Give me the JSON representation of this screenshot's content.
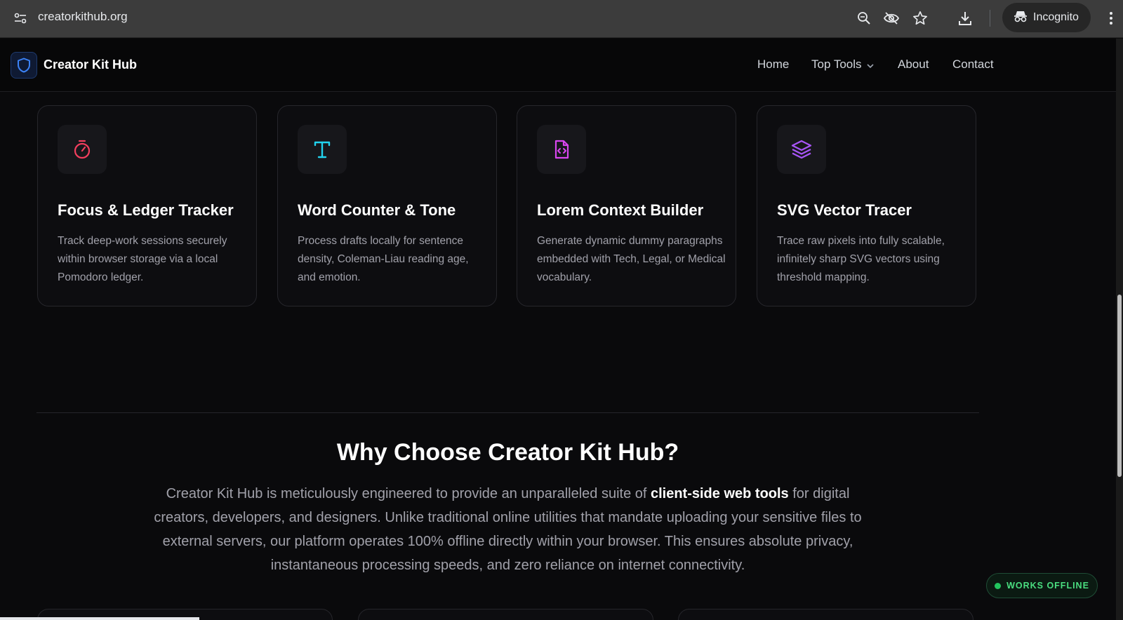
{
  "browser": {
    "url": "creatorkithub.org",
    "incognito_label": "Incognito",
    "icons": [
      "site-info-icon",
      "zoom-icon",
      "eye-off-icon",
      "star-icon",
      "download-icon",
      "incognito-icon",
      "more-icon"
    ]
  },
  "header": {
    "brand": "Creator Kit Hub",
    "nav": {
      "home": "Home",
      "top_tools": "Top Tools",
      "about": "About",
      "contact": "Contact"
    }
  },
  "tools": [
    {
      "title": "Focus & Ledger Tracker",
      "description": "Track deep-work sessions securely within browser storage via a local Pomodoro ledger.",
      "icon": "timer-icon",
      "color": "#f43f5e"
    },
    {
      "title": "Word Counter & Tone",
      "description": "Process drafts locally for sentence density, Coleman-Liau reading age, and emotion.",
      "icon": "type-icon",
      "color": "#22d3ee"
    },
    {
      "title": "Lorem Context Builder",
      "description": "Generate dynamic dummy paragraphs embedded with Tech, Legal, or Medical vocabulary.",
      "icon": "file-code-icon",
      "color": "#d946ef"
    },
    {
      "title": "SVG Vector Tracer",
      "description": "Trace raw pixels into fully scalable, infinitely sharp SVG vectors using threshold mapping.",
      "icon": "layers-icon",
      "color": "#a855f7"
    }
  ],
  "why": {
    "title": "Why Choose Creator Kit Hub?",
    "body_before": "Creator Kit Hub is meticulously engineered to provide an unparalleled suite of ",
    "body_bold": "client-side web tools",
    "body_after": " for digital creators, developers, and designers. Unlike traditional online utilities that mandate uploading your sensitive files to external servers, our platform operates 100% offline directly within your browser. This ensures absolute privacy, instantaneous processing speeds, and zero reliance on internet connectivity."
  },
  "badge": {
    "offline_label": "WORKS OFFLINE",
    "status_color": "#22c55e"
  },
  "colors": {
    "background": "#0a0a0c",
    "card_border": "#26262b",
    "brand_accent": "#3b82f6"
  }
}
